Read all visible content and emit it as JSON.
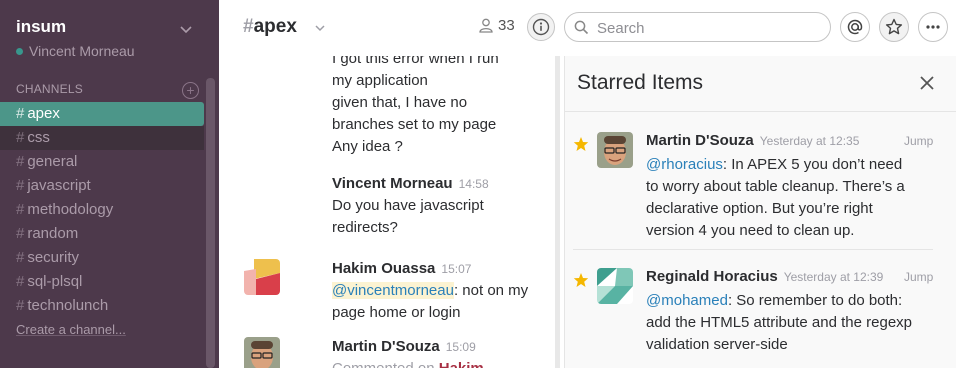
{
  "sidebar": {
    "team_name": "insum",
    "user_name": "Vincent Morneau",
    "channels_header": "CHANNELS",
    "add_channel_glyph": "+",
    "channels": [
      {
        "name": "apex"
      },
      {
        "name": "css"
      },
      {
        "name": "general"
      },
      {
        "name": "javascript"
      },
      {
        "name": "methodology"
      },
      {
        "name": "random"
      },
      {
        "name": "security"
      },
      {
        "name": "sql-plsql"
      },
      {
        "name": "technolunch"
      }
    ],
    "hash": "#",
    "create_channel": "Create a channel..."
  },
  "header": {
    "channel_hash": "#",
    "channel_name": "apex",
    "member_count": "33",
    "search_placeholder": "Search",
    "icons": [
      "person-icon",
      "info-icon",
      "search-icon",
      "at-icon",
      "star-icon",
      "more-icon"
    ]
  },
  "messages": {
    "m1_lines": [
      "I got this error when I run",
      "my application",
      "given that, I have no",
      "branches set to my page",
      "Any idea ?"
    ],
    "m2_sender": "Vincent Morneau",
    "m2_time": "14:58",
    "m2_lines": [
      "Do you have javascript",
      "redirects?"
    ],
    "m3_sender": "Hakim Ouassa",
    "m3_time": "15:07",
    "m3_mention": "@vincentmorneau",
    "m3_text": ": not on my",
    "m3_lines": [
      "page home or login"
    ],
    "m4_sender": "Martin D'Souza",
    "m4_time": "15:09",
    "m4_prefix": "Commented on ",
    "m4_link": "Hakim Ouassa",
    "m4_suffix": "'s"
  },
  "starred": {
    "title": "Starred Items",
    "items": [
      {
        "sender": "Martin D'Souza",
        "time": "Yesterday at 12:35",
        "jump": "Jump",
        "mention": "@rhoracius",
        "text": ": In APEX 5 you don’t need to worry about table cleanup. There’s a declarative option. But you’re right version 4 you need to clean up."
      },
      {
        "sender": "Reginald Horacius",
        "time": "Yesterday at 12:39",
        "jump": "Jump",
        "mention": "@mohamed",
        "text": ": So remember to do both: add the HTML5 attribute and the regexp validation server-side"
      }
    ]
  },
  "colors": {
    "sidebar_bg": "#4d394b",
    "active_channel": "#4c9689",
    "star_gold": "#f5b700",
    "link_blue": "#2a80b9"
  }
}
